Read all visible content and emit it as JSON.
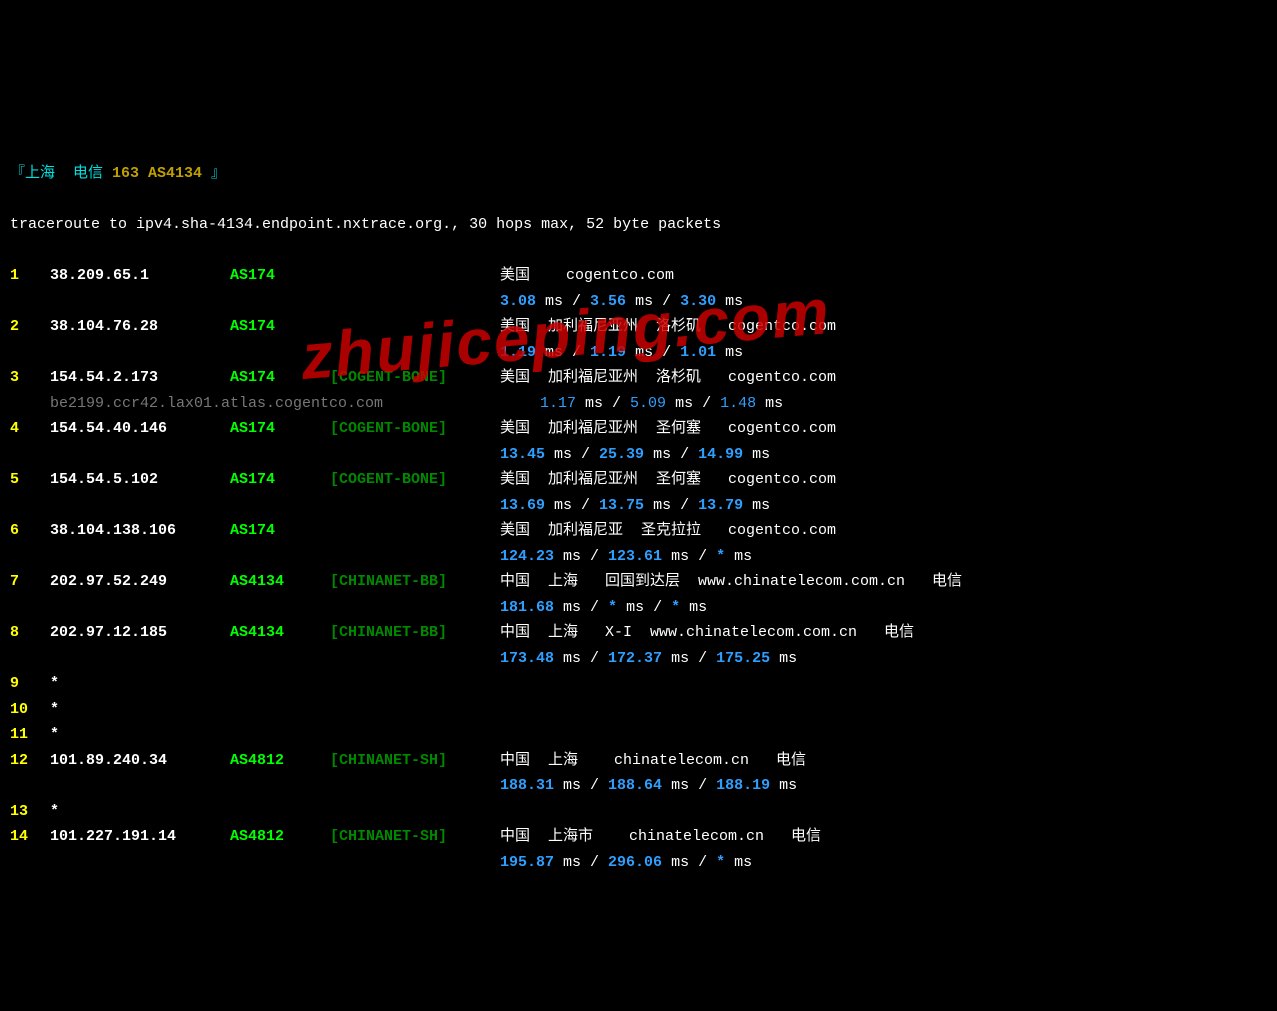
{
  "header": {
    "open": "『",
    "text1": "上海  电信 ",
    "text2": "163 AS4134",
    "close": " 』"
  },
  "cmd": "traceroute to ipv4.sha-4134.endpoint.nxtrace.org., 30 hops max, 52 byte packets",
  "hops": [
    {
      "n": "1",
      "ip": "38.209.65.1",
      "as": "AS174",
      "tag": "",
      "loc": "美国    cogentco.com",
      "lat": [
        "3.08",
        "3.56",
        "3.30"
      ]
    },
    {
      "n": "2",
      "ip": "38.104.76.28",
      "as": "AS174",
      "tag": "",
      "loc": "美国  加利福尼亚州  洛杉矶   cogentco.com",
      "lat": [
        "1.19",
        "1.19",
        "1.01"
      ]
    },
    {
      "n": "3",
      "ip": "154.54.2.173",
      "as": "AS174",
      "tag": "[COGENT-BONE]",
      "loc": "美国  加利福尼亚州  洛杉矶   cogentco.com",
      "lat": [
        "1.17",
        "5.09",
        "1.48"
      ],
      "sub": "be2199.ccr42.lax01.atlas.cogentco.com"
    },
    {
      "n": "4",
      "ip": "154.54.40.146",
      "as": "AS174",
      "tag": "[COGENT-BONE]",
      "loc": "美国  加利福尼亚州  圣何塞   cogentco.com",
      "lat": [
        "13.45",
        "25.39",
        "14.99"
      ]
    },
    {
      "n": "5",
      "ip": "154.54.5.102",
      "as": "AS174",
      "tag": "[COGENT-BONE]",
      "loc": "美国  加利福尼亚州  圣何塞   cogentco.com",
      "lat": [
        "13.69",
        "13.75",
        "13.79"
      ]
    },
    {
      "n": "6",
      "ip": "38.104.138.106",
      "as": "AS174",
      "tag": "",
      "loc": "美国  加利福尼亚  圣克拉拉   cogentco.com",
      "lat": [
        "124.23",
        "123.61",
        "*"
      ]
    },
    {
      "n": "7",
      "ip": "202.97.52.249",
      "as": "AS4134",
      "tag": "[CHINANET-BB]",
      "loc": "中国  上海   回国到达层  www.chinatelecom.com.cn   电信",
      "lat": [
        "181.68",
        "*",
        "*"
      ]
    },
    {
      "n": "8",
      "ip": "202.97.12.185",
      "as": "AS4134",
      "tag": "[CHINANET-BB]",
      "loc": "中国  上海   X-I  www.chinatelecom.com.cn   电信",
      "lat": [
        "173.48",
        "172.37",
        "175.25"
      ]
    },
    {
      "n": "9",
      "ip": "*"
    },
    {
      "n": "10",
      "ip": "*"
    },
    {
      "n": "11",
      "ip": "*"
    },
    {
      "n": "12",
      "ip": "101.89.240.34",
      "as": "AS4812",
      "tag": "[CHINANET-SH]",
      "loc": "中国  上海    chinatelecom.cn   电信",
      "lat": [
        "188.31",
        "188.64",
        "188.19"
      ]
    },
    {
      "n": "13",
      "ip": "*"
    },
    {
      "n": "14",
      "ip": "101.227.191.14",
      "as": "AS4812",
      "tag": "[CHINANET-SH]",
      "loc": "中国  上海市    chinatelecom.cn   电信",
      "lat": [
        "195.87",
        "296.06",
        "*"
      ]
    }
  ],
  "watermark": "zhujiceping.com"
}
